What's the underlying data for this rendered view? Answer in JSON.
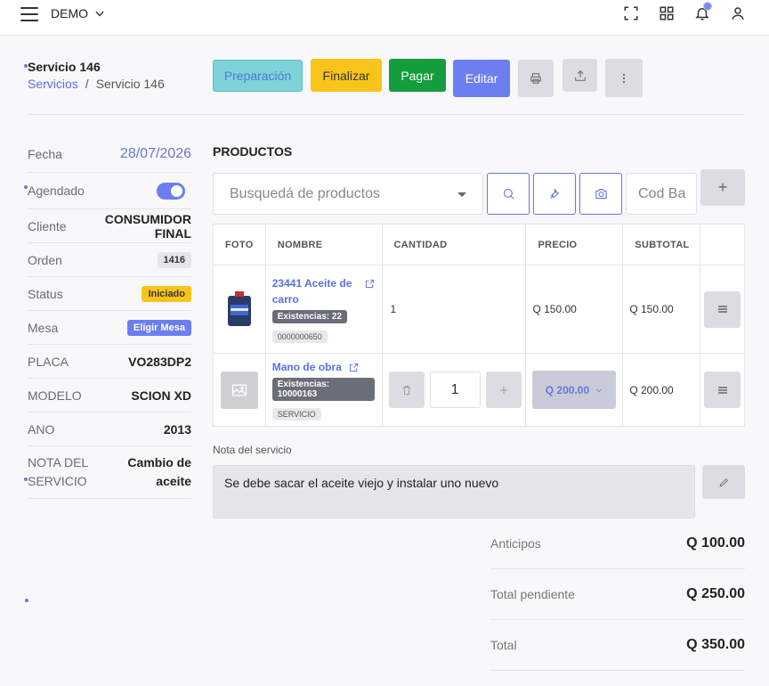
{
  "topbar": {
    "brand": "DEMO"
  },
  "header": {
    "title": "Servicio 146",
    "breadcrumb": {
      "link": "Servicios",
      "separator": "/",
      "current": "Servicio 146"
    }
  },
  "actions": {
    "preparacion": "Preparación",
    "finalizar": "Finalizar",
    "pagar": "Pagar",
    "editar": "Editar"
  },
  "info": {
    "fecha": {
      "label": "Fecha",
      "value": "28/07/2026"
    },
    "agendado": {
      "label": "Agendado",
      "on": true
    },
    "cliente": {
      "label": "Cliente",
      "value": "CONSUMIDOR FINAL"
    },
    "orden": {
      "label": "Orden",
      "value": "1416"
    },
    "status": {
      "label": "Status",
      "value": "Iniciado"
    },
    "mesa": {
      "label": "Mesa",
      "value": "Elígir Mesa"
    },
    "placa": {
      "label": "PLACA",
      "value": "VO283DP2"
    },
    "modelo": {
      "label": "MODELO",
      "value": "SCION XD"
    },
    "ano": {
      "label": "ANO",
      "value": "2013"
    },
    "nota": {
      "label": "NOTA DEL SERVICIO",
      "value": "Cambio de aceite"
    }
  },
  "productos": {
    "title": "PRODUCTOS",
    "search_placeholder": "Busquedá de productos",
    "cod_placeholder": "Cod Ba",
    "plus": "+",
    "columns": [
      "FOTO",
      "NOMBRE",
      "CANTIDAD",
      "PRECIO",
      "SUBTOTAL",
      ""
    ],
    "rows": [
      {
        "name": "23441 Aceite de carro",
        "stock": "Existencias: 22",
        "code": "0000000650",
        "quantity": "1",
        "price": "Q 150.00",
        "subtotal": "Q 150.00"
      },
      {
        "name": "Mano de obra",
        "stock": "Existencias: 10000163",
        "code": "SERVICIO",
        "quantity": "1",
        "price": "Q 200.00",
        "subtotal": "Q 200.00"
      }
    ]
  },
  "nota_servicio": {
    "label": "Nota del servicio",
    "text": "Se debe sacar el aceite viejo y instalar uno nuevo"
  },
  "totals": {
    "anticipos": {
      "label": "Anticipos",
      "value": "Q 100.00"
    },
    "pendiente": {
      "label": "Total pendiente",
      "value": "Q 250.00"
    },
    "total": {
      "label": "Total",
      "value": "Q 350.00"
    }
  },
  "colors": {
    "primary": "#6c7ef0",
    "warning": "#f8c41a",
    "success": "#149d3c",
    "info": "#7fd3d8"
  }
}
